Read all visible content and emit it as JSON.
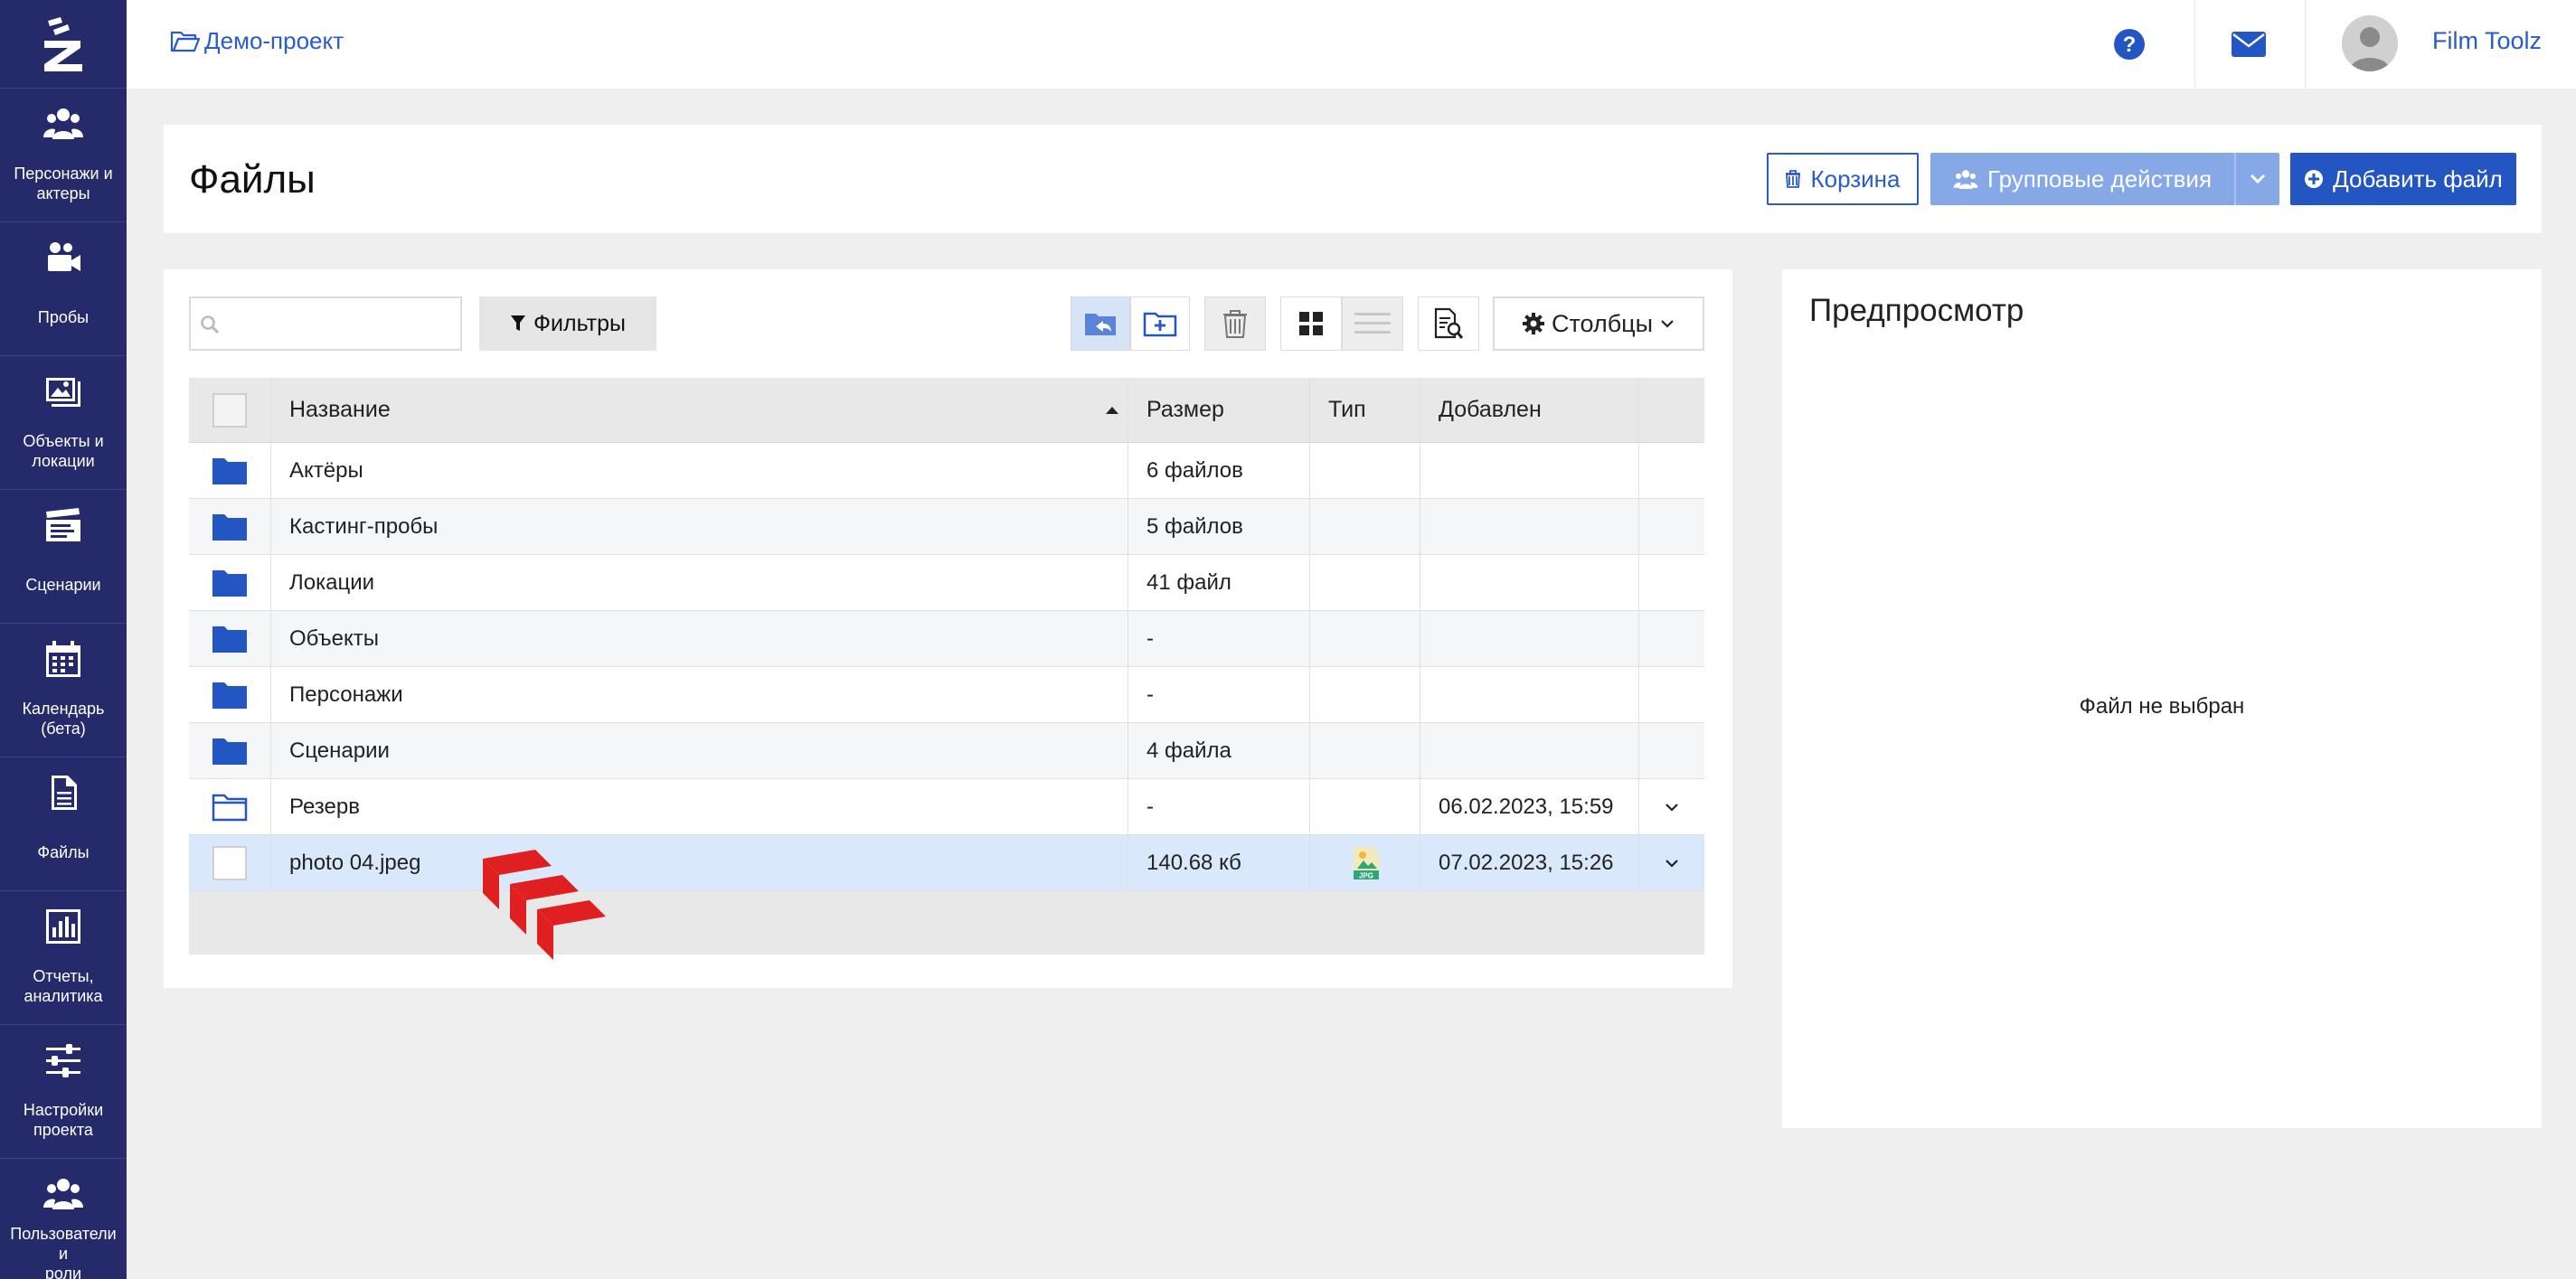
{
  "sidebar": {
    "items": [
      {
        "label": "Персонажи и\nактеры",
        "icon": "users-icon"
      },
      {
        "label": "Пробы",
        "icon": "video-camera-icon"
      },
      {
        "label": "Объекты и\nлокации",
        "icon": "images-icon"
      },
      {
        "label": "Сценарии",
        "icon": "clapperboard-icon"
      },
      {
        "label": "Календарь\n(бета)",
        "icon": "calendar-icon"
      },
      {
        "label": "Файлы",
        "icon": "file-icon"
      },
      {
        "label": "Отчеты,\nаналитика",
        "icon": "bar-chart-icon"
      },
      {
        "label": "Настройки\nпроекта",
        "icon": "sliders-icon"
      },
      {
        "label": "Пользователи и\nроли",
        "icon": "users-icon"
      }
    ]
  },
  "topbar": {
    "breadcrumb": "Демо-проект",
    "user_name": "Film Toolz"
  },
  "header": {
    "title": "Файлы",
    "trash_label": "Корзина",
    "group_actions_label": "Групповые действия",
    "add_file_label": "Добавить файл"
  },
  "toolbar": {
    "search_placeholder": "",
    "filters_label": "Фильтры",
    "columns_label": "Столбцы"
  },
  "table": {
    "columns": [
      "Название",
      "Размер",
      "Тип",
      "Добавлен"
    ],
    "rows": [
      {
        "name": "Актёры",
        "size": "6 файлов",
        "type": "",
        "added": "",
        "kind": "folder"
      },
      {
        "name": "Кастинг-пробы",
        "size": "5 файлов",
        "type": "",
        "added": "",
        "kind": "folder"
      },
      {
        "name": "Локации",
        "size": "41 файл",
        "type": "",
        "added": "",
        "kind": "folder"
      },
      {
        "name": "Объекты",
        "size": "-",
        "type": "",
        "added": "",
        "kind": "folder"
      },
      {
        "name": "Персонажи",
        "size": "-",
        "type": "",
        "added": "",
        "kind": "folder"
      },
      {
        "name": "Сценарии",
        "size": "4 файла",
        "type": "",
        "added": "",
        "kind": "folder"
      },
      {
        "name": "Резерв",
        "size": "-",
        "type": "",
        "added": "06.02.2023, 15:59",
        "kind": "folder-outline"
      },
      {
        "name": "photo 04.jpeg",
        "size": "140.68 кб",
        "type": "JPG",
        "added": "07.02.2023, 15:26",
        "kind": "file"
      }
    ]
  },
  "preview": {
    "title": "Предпросмотр",
    "empty_text": "Файл не выбран"
  },
  "colors": {
    "sidebar_bg": "#252a6b",
    "accent": "#2456c3",
    "group_button": "#86a8e6",
    "selected_row": "#dae8fb",
    "watermark": "#e02020"
  }
}
